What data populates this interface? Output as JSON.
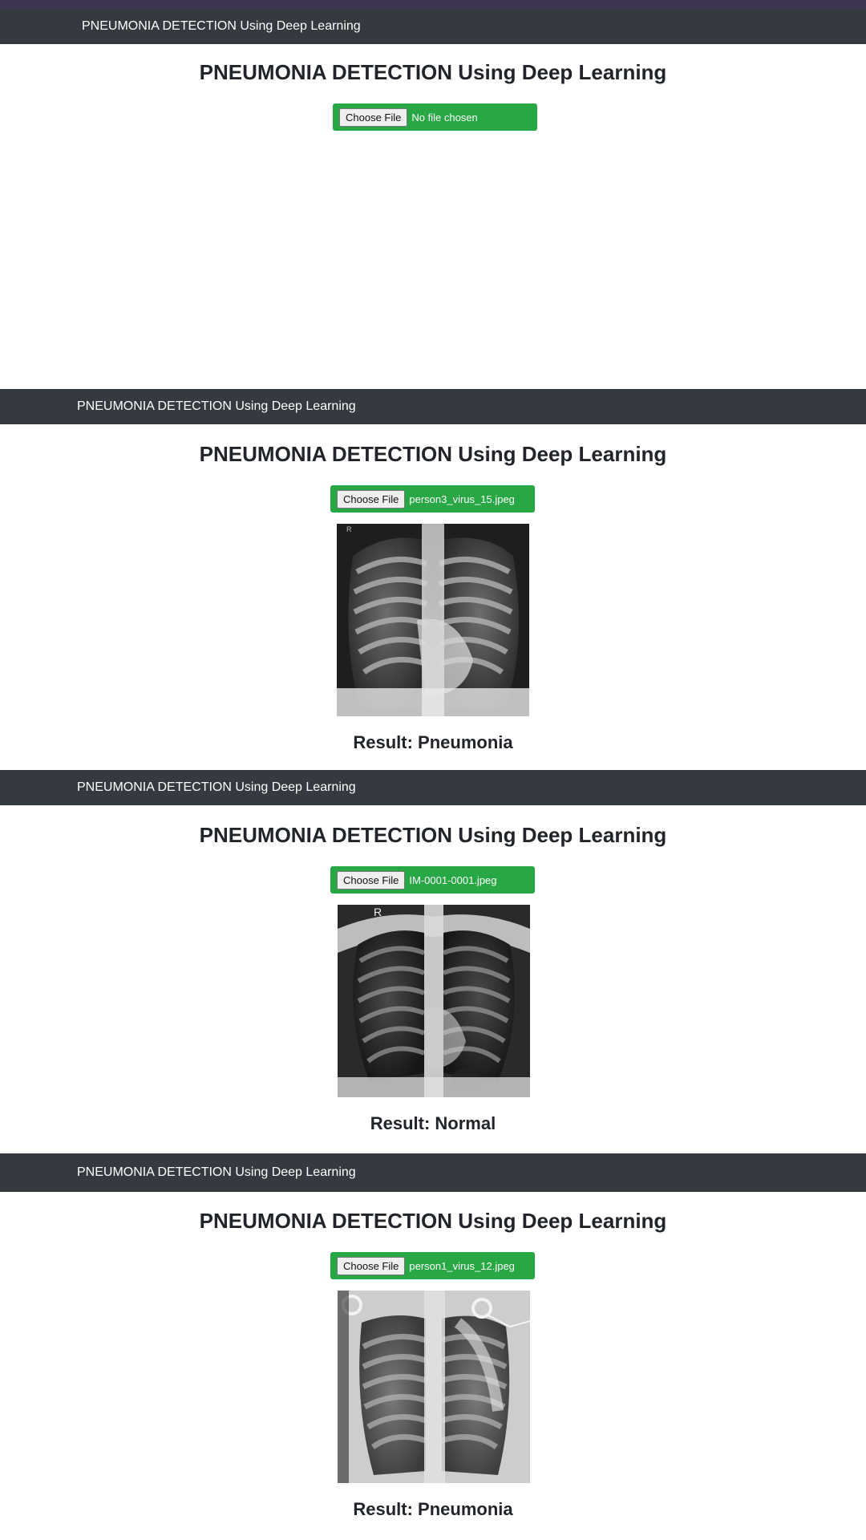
{
  "navbar": {
    "brand": "PNEUMONIA DETECTION Using Deep Learning"
  },
  "page": {
    "title": "PNEUMONIA DETECTION Using Deep Learning"
  },
  "upload": {
    "button_label": "Choose File"
  },
  "panels": [
    {
      "file_name": "No file chosen",
      "result": ""
    },
    {
      "file_name": "person3_virus_15.jpeg",
      "xray_marker": "R",
      "result": "Result: Pneumonia"
    },
    {
      "file_name": "IM-0001-0001.jpeg",
      "xray_marker": "R",
      "result": "Result: Normal"
    },
    {
      "file_name": "person1_virus_12.jpeg",
      "result": "Result: Pneumonia"
    }
  ],
  "colors": {
    "navbar": "#343a40",
    "upload_box": "#28a745",
    "top_strip": "#3e3552"
  },
  "icons": {
    "xray_image": "chest-xray-image"
  }
}
